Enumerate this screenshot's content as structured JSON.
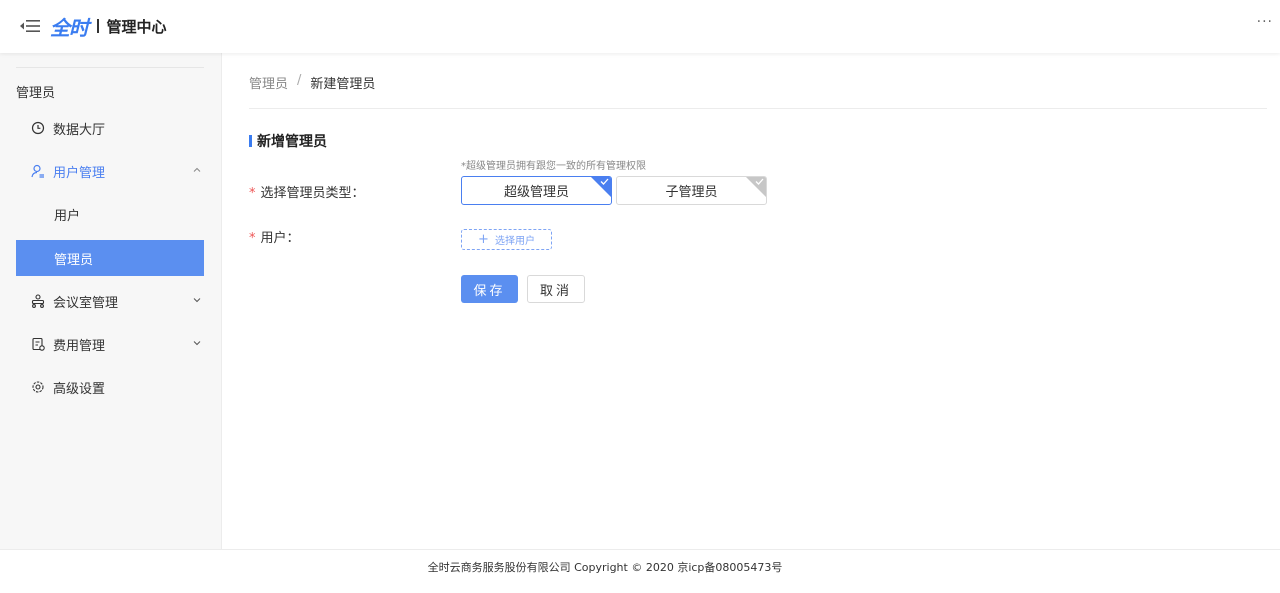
{
  "header": {
    "logo_text": "全时",
    "app_title": "管理中心",
    "more": "···"
  },
  "sidebar": {
    "heading": "管理员",
    "items": [
      {
        "label": "数据大厅",
        "icon": "clock-icon"
      },
      {
        "label": "用户管理",
        "icon": "user-icon",
        "expanded": true
      },
      {
        "label": "用户"
      },
      {
        "label": "管理员",
        "active": true
      },
      {
        "label": "会议室管理",
        "icon": "meeting-icon"
      },
      {
        "label": "费用管理",
        "icon": "bill-icon"
      },
      {
        "label": "高级设置",
        "icon": "settings-icon"
      }
    ]
  },
  "main": {
    "breadcrumb": {
      "parent": "管理员",
      "separator": "/",
      "current": "新建管理员"
    },
    "section_title": "新增管理员",
    "hint": "*超级管理员拥有跟您一致的所有管理权限",
    "form": {
      "type_label": "选择管理员类型：",
      "type_required": "*",
      "type_options": [
        "超级管理员",
        "子管理员"
      ],
      "user_label": "用户：",
      "user_required": "*",
      "select_user_plus": "+",
      "select_user": "选择用户",
      "save": "保存",
      "cancel": "取消"
    }
  },
  "footer": {
    "text": "全时云商务服务股份有限公司 Copyright © 2020 京icp备08005473号"
  },
  "colors": {
    "accent": "#4a7ff0",
    "active_bg": "#5b8ff0",
    "required": "#e55"
  }
}
